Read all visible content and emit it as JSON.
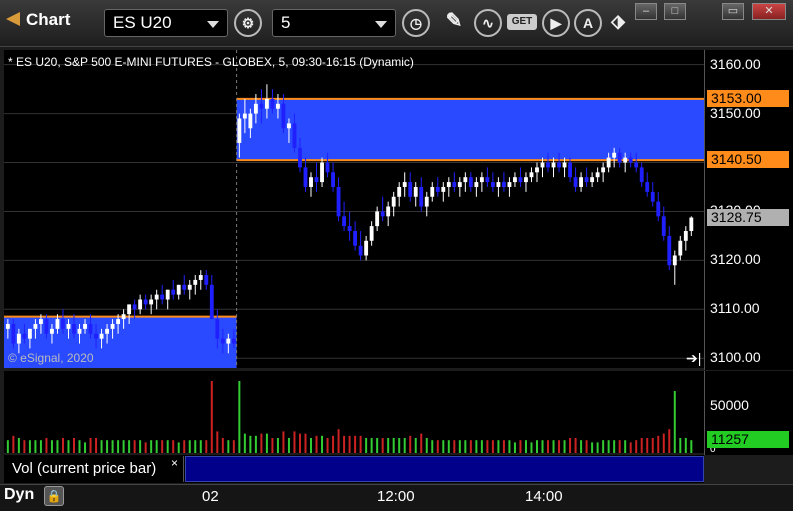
{
  "window": {
    "title": "Chart",
    "symbol": "ES U20",
    "interval": "5",
    "buttons": {
      "minimize": "–",
      "restore": "□",
      "maximize": "▭",
      "close": "✕"
    },
    "toolbar_icons": [
      "settings-gear-icon",
      "clock-icon",
      "pencil-icon",
      "study-icon",
      "get-icon",
      "play-icon",
      "alert-icon",
      "link-icon"
    ]
  },
  "chart": {
    "subtitle": "* ES U20, S&P 500 E-MINI FUTURES - GLOBEX, 5, 09:30-16:15 (Dynamic)",
    "copyright": "© eSignal, 2020",
    "price_ticks": [
      "3160.00",
      "3150.00",
      "3140.00",
      "3130.00",
      "3120.00",
      "3110.00",
      "3100.00"
    ],
    "price_tags": {
      "upper": "3153.00",
      "lower": "3140.50",
      "last": "3128.75"
    },
    "colors": {
      "up": "#ffffff",
      "down": "#2020ff",
      "zone": "#2a4aff",
      "zone_line": "#ff8c1a",
      "tag": "#ff8c1a",
      "last_tag": "#b0b0b0"
    }
  },
  "chart_data": {
    "type": "candlestick",
    "y_range": [
      3098,
      3163
    ],
    "zones": [
      {
        "from_bar": 0,
        "to_bar": 42,
        "low": 3098,
        "high": 3108.5
      },
      {
        "from_bar": 42,
        "to_bar": 144,
        "low": 3140.5,
        "high": 3153
      }
    ],
    "candles": [
      [
        3106,
        3108,
        3104,
        3107
      ],
      [
        3107,
        3108,
        3102,
        3103
      ],
      [
        3103,
        3106,
        3101,
        3105
      ],
      [
        3105,
        3107,
        3103,
        3104
      ],
      [
        3104,
        3106,
        3102,
        3106
      ],
      [
        3106,
        3108,
        3104,
        3107
      ],
      [
        3107,
        3109,
        3105,
        3108
      ],
      [
        3108,
        3109,
        3104,
        3105
      ],
      [
        3105,
        3107,
        3103,
        3106
      ],
      [
        3106,
        3109,
        3105,
        3108
      ],
      [
        3108,
        3110,
        3105,
        3106
      ],
      [
        3106,
        3108,
        3104,
        3107
      ],
      [
        3107,
        3109,
        3104,
        3105
      ],
      [
        3105,
        3107,
        3103,
        3106
      ],
      [
        3106,
        3108,
        3105,
        3107
      ],
      [
        3107,
        3109,
        3104,
        3105
      ],
      [
        3105,
        3107,
        3102,
        3104
      ],
      [
        3104,
        3106,
        3102,
        3105
      ],
      [
        3105,
        3107,
        3103,
        3106
      ],
      [
        3106,
        3108,
        3104,
        3107
      ],
      [
        3107,
        3109,
        3105,
        3108
      ],
      [
        3108,
        3110,
        3106,
        3109
      ],
      [
        3109,
        3111,
        3107,
        3111
      ],
      [
        3111,
        3112,
        3108,
        3110
      ],
      [
        3110,
        3113,
        3109,
        3112
      ],
      [
        3112,
        3113,
        3110,
        3111
      ],
      [
        3111,
        3113,
        3109,
        3112
      ],
      [
        3112,
        3114,
        3110,
        3113
      ],
      [
        3113,
        3115,
        3111,
        3112
      ],
      [
        3112,
        3114,
        3110,
        3114
      ],
      [
        3114,
        3116,
        3112,
        3113
      ],
      [
        3113,
        3115,
        3112,
        3115
      ],
      [
        3115,
        3117,
        3113,
        3114
      ],
      [
        3114,
        3116,
        3112,
        3115
      ],
      [
        3115,
        3117,
        3113,
        3116
      ],
      [
        3116,
        3118,
        3114,
        3117
      ],
      [
        3117,
        3118,
        3114,
        3115
      ],
      [
        3115,
        3117,
        3108,
        3108
      ],
      [
        3108,
        3110,
        3102,
        3104
      ],
      [
        3104,
        3106,
        3101,
        3103
      ],
      [
        3103,
        3105,
        3101,
        3104
      ],
      [
        3104,
        3106,
        3102,
        3103
      ],
      [
        3144,
        3150,
        3141,
        3149
      ],
      [
        3149,
        3153,
        3146,
        3150
      ],
      [
        3147,
        3151,
        3145,
        3150
      ],
      [
        3150,
        3154,
        3148,
        3152
      ],
      [
        3152,
        3155,
        3148,
        3151
      ],
      [
        3151,
        3156,
        3149,
        3153
      ],
      [
        3153,
        3155,
        3150,
        3151
      ],
      [
        3151,
        3154,
        3149,
        3152
      ],
      [
        3152,
        3154,
        3146,
        3147
      ],
      [
        3147,
        3149,
        3144,
        3148
      ],
      [
        3148,
        3150,
        3142,
        3143
      ],
      [
        3143,
        3145,
        3138,
        3139
      ],
      [
        3139,
        3141,
        3134,
        3135
      ],
      [
        3135,
        3138,
        3133,
        3137
      ],
      [
        3137,
        3140,
        3134,
        3136
      ],
      [
        3136,
        3141,
        3135,
        3140
      ],
      [
        3140,
        3142,
        3137,
        3138
      ],
      [
        3138,
        3140,
        3134,
        3135
      ],
      [
        3135,
        3137,
        3128,
        3129
      ],
      [
        3129,
        3132,
        3126,
        3127
      ],
      [
        3127,
        3130,
        3124,
        3126
      ],
      [
        3126,
        3128,
        3122,
        3123
      ],
      [
        3123,
        3126,
        3120,
        3121
      ],
      [
        3121,
        3125,
        3120,
        3124
      ],
      [
        3124,
        3128,
        3123,
        3127
      ],
      [
        3127,
        3131,
        3126,
        3130
      ],
      [
        3130,
        3133,
        3128,
        3129
      ],
      [
        3129,
        3132,
        3127,
        3131
      ],
      [
        3131,
        3134,
        3129,
        3133
      ],
      [
        3133,
        3136,
        3131,
        3135
      ],
      [
        3135,
        3138,
        3133,
        3136
      ],
      [
        3136,
        3138,
        3132,
        3133
      ],
      [
        3133,
        3136,
        3131,
        3135
      ],
      [
        3135,
        3137,
        3130,
        3131
      ],
      [
        3131,
        3134,
        3129,
        3133
      ],
      [
        3133,
        3136,
        3132,
        3135
      ],
      [
        3135,
        3137,
        3133,
        3134
      ],
      [
        3134,
        3136,
        3132,
        3135
      ],
      [
        3135,
        3137,
        3133,
        3136
      ],
      [
        3136,
        3138,
        3134,
        3135
      ],
      [
        3135,
        3137,
        3133,
        3136
      ],
      [
        3136,
        3138,
        3134,
        3137
      ],
      [
        3137,
        3138,
        3134,
        3135
      ],
      [
        3135,
        3137,
        3133,
        3136
      ],
      [
        3136,
        3138,
        3134,
        3137
      ],
      [
        3137,
        3139,
        3135,
        3136
      ],
      [
        3136,
        3138,
        3134,
        3135
      ],
      [
        3135,
        3137,
        3133,
        3136
      ],
      [
        3136,
        3138,
        3134,
        3135
      ],
      [
        3135,
        3137,
        3133,
        3136
      ],
      [
        3136,
        3138,
        3135,
        3137
      ],
      [
        3137,
        3139,
        3135,
        3136
      ],
      [
        3136,
        3138,
        3134,
        3137
      ],
      [
        3137,
        3139,
        3136,
        3138
      ],
      [
        3138,
        3140,
        3136,
        3139
      ],
      [
        3139,
        3141,
        3137,
        3140
      ],
      [
        3140,
        3142,
        3138,
        3139
      ],
      [
        3139,
        3141,
        3137,
        3140
      ],
      [
        3140,
        3142,
        3138,
        3139
      ],
      [
        3139,
        3141,
        3137,
        3140
      ],
      [
        3140,
        3141,
        3136,
        3137
      ],
      [
        3137,
        3139,
        3134,
        3135
      ],
      [
        3135,
        3138,
        3134,
        3137
      ],
      [
        3137,
        3139,
        3135,
        3136
      ],
      [
        3136,
        3138,
        3135,
        3137
      ],
      [
        3137,
        3139,
        3136,
        3138
      ],
      [
        3138,
        3140,
        3136,
        3139
      ],
      [
        3139,
        3142,
        3138,
        3141
      ],
      [
        3141,
        3143,
        3139,
        3142
      ],
      [
        3142,
        3143,
        3139,
        3140
      ],
      [
        3140,
        3142,
        3138,
        3141
      ],
      [
        3141,
        3142,
        3139,
        3140
      ],
      [
        3140,
        3142,
        3138,
        3139
      ],
      [
        3139,
        3140,
        3135,
        3136
      ],
      [
        3136,
        3138,
        3133,
        3134
      ],
      [
        3134,
        3136,
        3131,
        3132
      ],
      [
        3132,
        3134,
        3128,
        3129
      ],
      [
        3129,
        3131,
        3124,
        3125
      ],
      [
        3125,
        3127,
        3118,
        3119
      ],
      [
        3119,
        3122,
        3115,
        3121
      ],
      [
        3121,
        3125,
        3120,
        3124
      ],
      [
        3124,
        3127,
        3122,
        3126
      ],
      [
        3126,
        3129,
        3125,
        3128.75
      ]
    ],
    "volume_axis": {
      "ticks": [
        "50000",
        "0"
      ],
      "last": "11257"
    },
    "x_ticks": [
      "02",
      "12:00",
      "14:00"
    ]
  },
  "volume_panel": {
    "label": "Vol (current price bar)",
    "close": "×"
  },
  "footer": {
    "mode": "Dyn"
  }
}
